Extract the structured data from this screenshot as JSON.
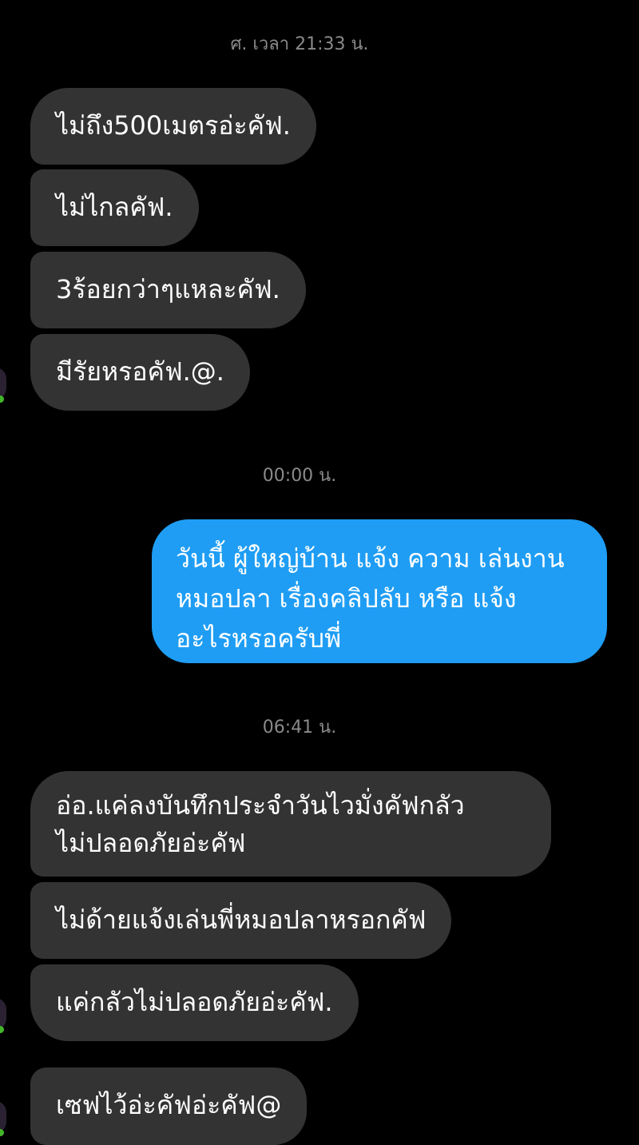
{
  "timestamps": {
    "t1": "ศ. เวลา 21:33 น.",
    "t2": "00:00 น.",
    "t3": "06:41 น."
  },
  "messages": [
    {
      "side": "incoming",
      "text": "ไม่ถึง500เมตรอ่ะคัฟ."
    },
    {
      "side": "incoming",
      "text": "ไม่ไกลคัฟ."
    },
    {
      "side": "incoming",
      "text": "3ร้อยกว่าๆแหละคัฟ."
    },
    {
      "side": "incoming",
      "text": "มีรัยหรอคัฟ.@."
    },
    {
      "side": "outgoing",
      "lines": [
        "วันนี้ ผู้ใหญ่บ้าน แจ้ง ความ เล่นงาน",
        "หมอปลา เรื่องคลิปลับ หรือ แจ้ง",
        "อะไรหรอครับพี่"
      ]
    },
    {
      "side": "incoming",
      "lines": [
        "อ่อ.แค่ลงบันทึกประจำวันไวมั่งคัฟกลัว",
        "ไม่ปลอดภัยอ่ะคัฟ"
      ]
    },
    {
      "side": "incoming",
      "text": "ไม่ด้ายแจ้งเล่นพี่หมอปลาหรอกคัฟ"
    },
    {
      "side": "incoming",
      "text": "แค่กลัวไม่ปลอดภัยอ่ะคัฟ."
    },
    {
      "side": "incoming",
      "text": "เซฟไว้อ่ะคัฟอ่ะคัฟ@"
    }
  ],
  "colors": {
    "background": "#000000",
    "incoming_bubble": "#333333",
    "outgoing_bubble": "#1f9df4",
    "timestamp": "#8a8a8a",
    "online_dot": "#42b72a"
  }
}
